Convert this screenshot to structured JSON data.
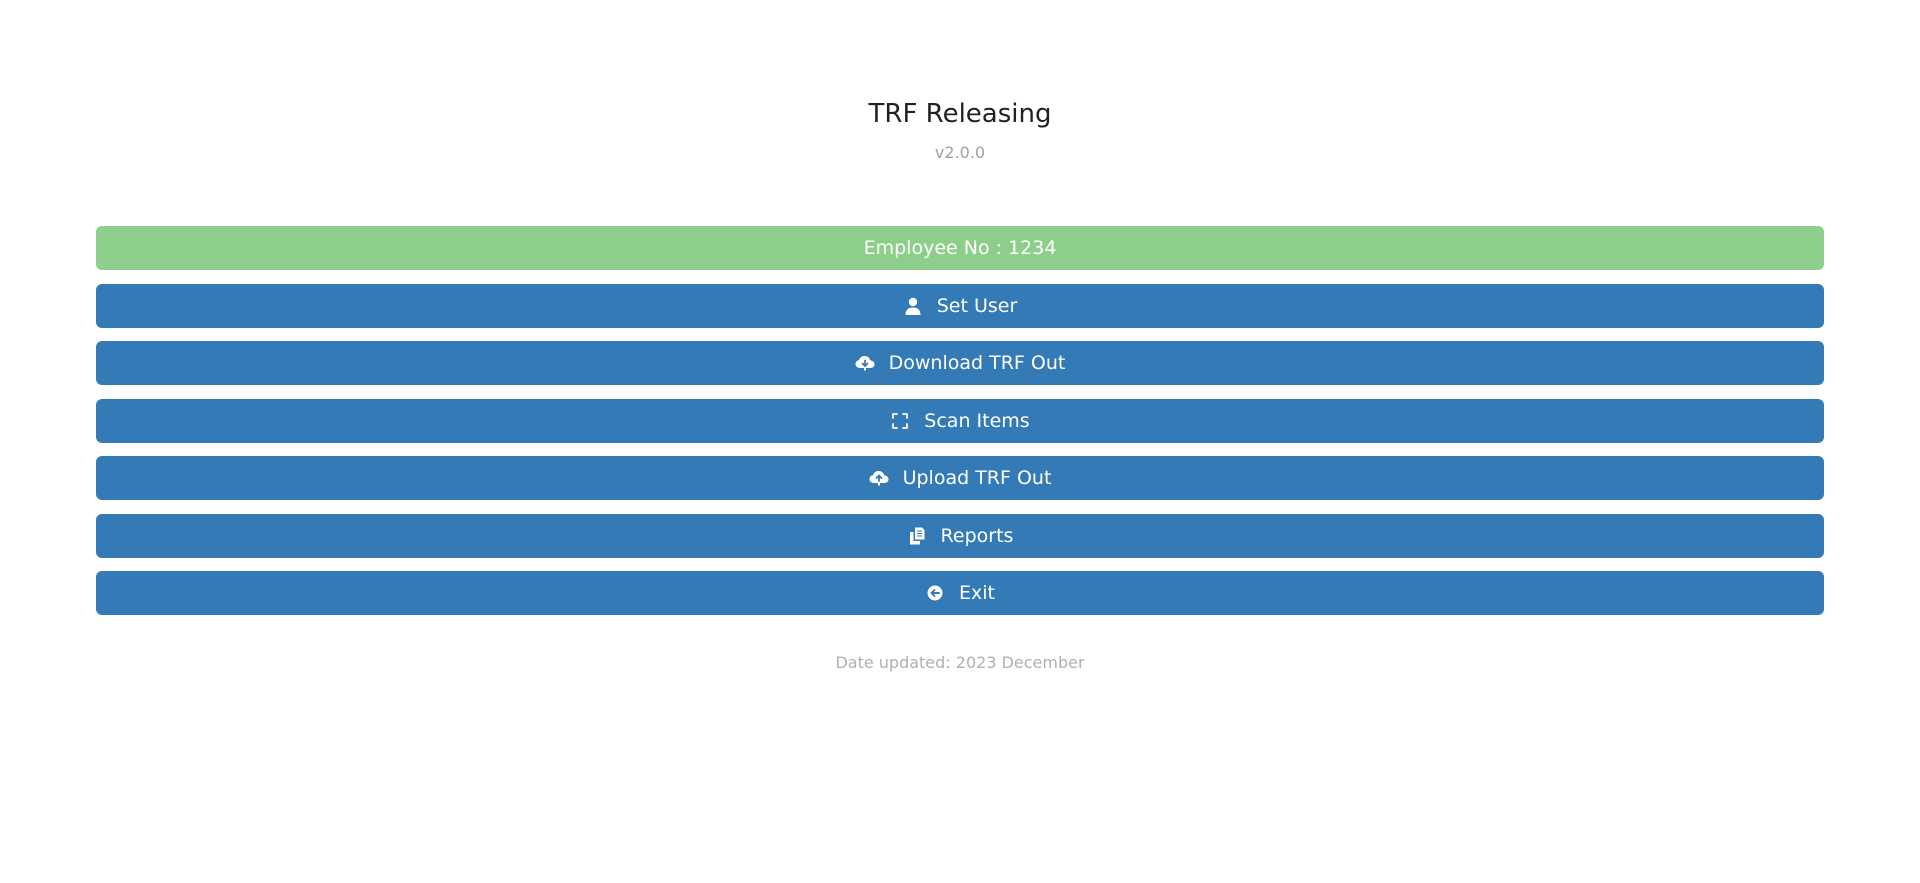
{
  "header": {
    "title": "TRF Releasing",
    "version": "v2.0.0"
  },
  "employee": {
    "label": "Employee No : 1234"
  },
  "menu": {
    "items": [
      {
        "label": "Set User",
        "icon": "user-icon"
      },
      {
        "label": "Download TRF Out",
        "icon": "cloud-download-icon"
      },
      {
        "label": "Scan Items",
        "icon": "scan-icon"
      },
      {
        "label": "Upload TRF Out",
        "icon": "cloud-upload-icon"
      },
      {
        "label": "Reports",
        "icon": "copy-documents-icon"
      },
      {
        "label": "Exit",
        "icon": "arrow-circle-left-icon"
      }
    ]
  },
  "footer": {
    "date_updated": "Date updated: 2023 December"
  },
  "colors": {
    "primary": "#337ab7",
    "success": "#8ece8b",
    "muted": "#a0a0a0",
    "title": "#222222"
  }
}
